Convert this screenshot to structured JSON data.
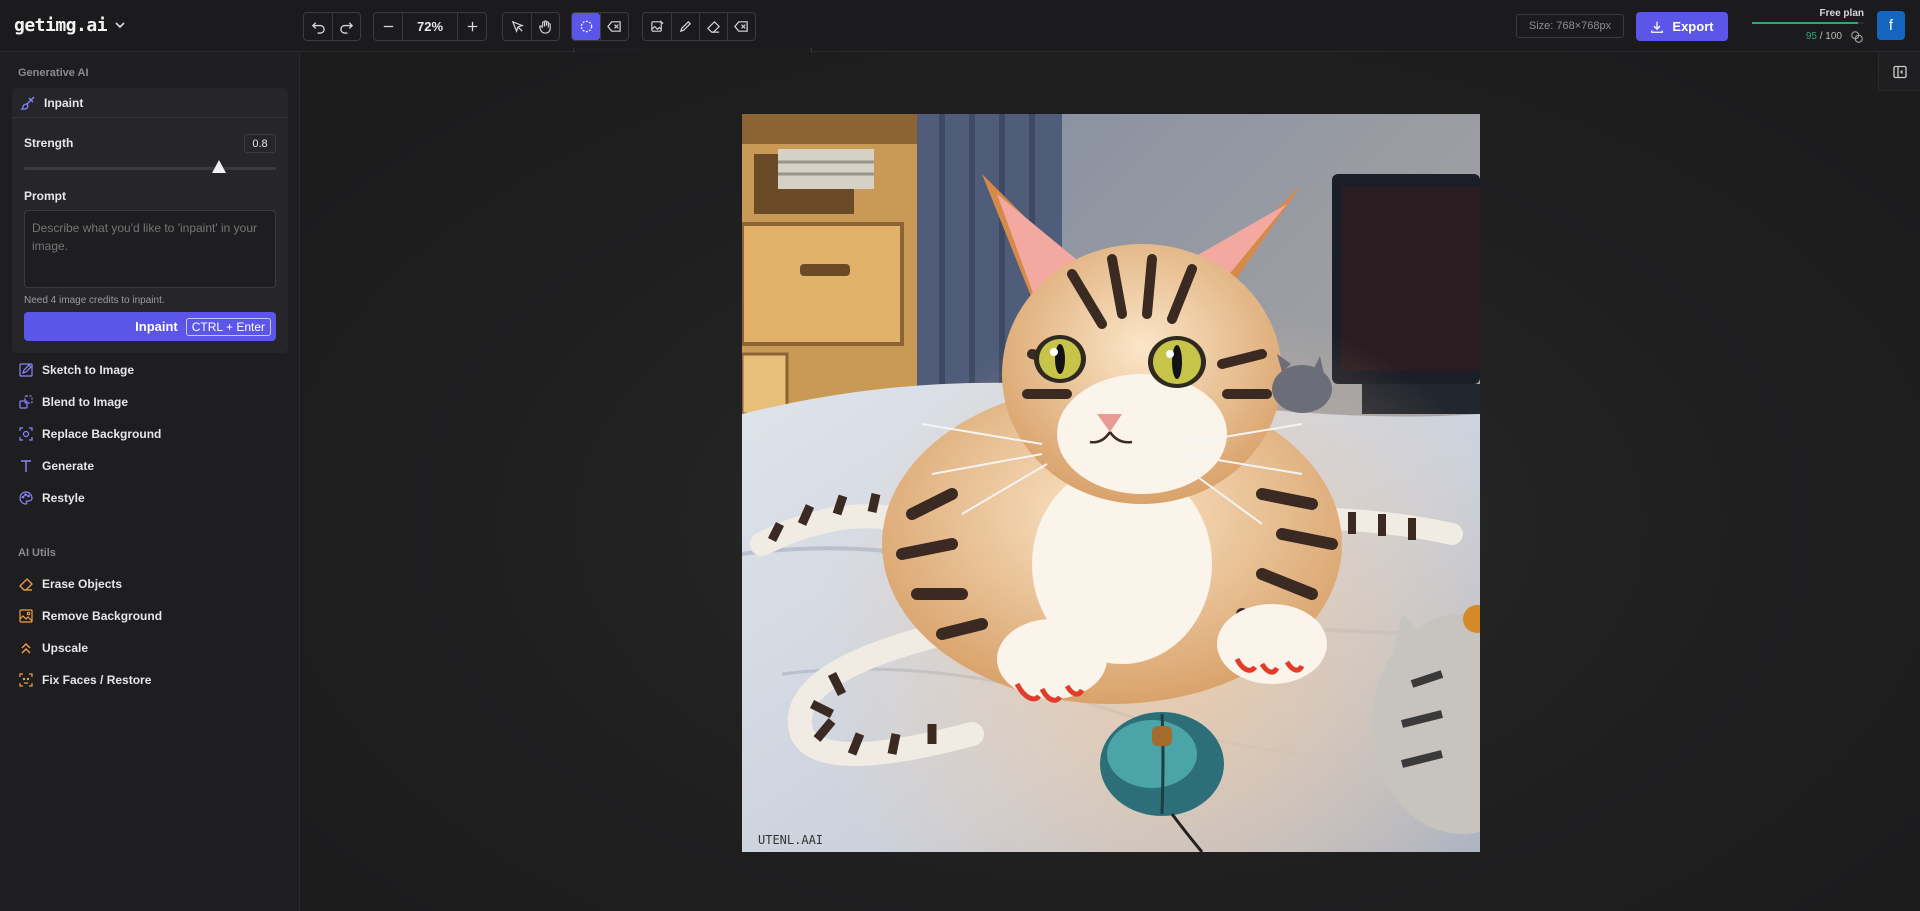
{
  "app": {
    "logo": "getimg.ai"
  },
  "toolbar": {
    "zoom": "72%",
    "brush_size": "64",
    "size_label": "Size: 768×768px",
    "export_label": "Export"
  },
  "account": {
    "plan": "Free plan",
    "credits_used": "95",
    "credits_total": "/ 100",
    "avatar_letter": "f"
  },
  "sidebar": {
    "generative_title": "Generative AI",
    "inpaint": {
      "title": "Inpaint",
      "strength_label": "Strength",
      "strength_value": "0.8",
      "prompt_label": "Prompt",
      "prompt_placeholder": "Describe what you'd like to 'inpaint' in your image.",
      "credits_note": "Need 4 image credits to inpaint.",
      "button_label": "Inpaint",
      "shortcut": "CTRL + Enter"
    },
    "generative_items": [
      {
        "label": "Sketch to Image",
        "icon": "sketch-icon"
      },
      {
        "label": "Blend to Image",
        "icon": "blend-icon"
      },
      {
        "label": "Replace Background",
        "icon": "replace-background-icon"
      },
      {
        "label": "Generate",
        "icon": "text-icon"
      },
      {
        "label": "Restyle",
        "icon": "palette-icon"
      }
    ],
    "utils_title": "AI Utils",
    "utils_items": [
      {
        "label": "Erase Objects",
        "icon": "eraser-icon"
      },
      {
        "label": "Remove Background",
        "icon": "remove-background-icon"
      },
      {
        "label": "Upscale",
        "icon": "upscale-icon"
      },
      {
        "label": "Fix Faces / Restore",
        "icon": "face-scan-icon"
      }
    ]
  },
  "canvas": {
    "watermark": "UTENL.AAI"
  },
  "colors": {
    "accent": "#5b55e8",
    "success": "#2ea87a",
    "avatar": "#1565c0"
  }
}
